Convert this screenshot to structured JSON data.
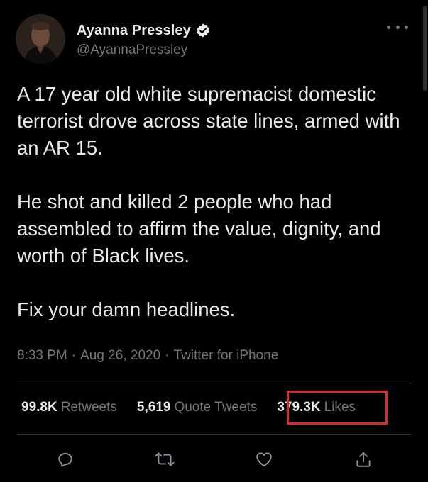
{
  "author": {
    "display_name": "Ayanna Pressley",
    "handle": "@AyannaPressley",
    "verified": true,
    "avatar_icon": "profile-photo"
  },
  "tweet": {
    "paragraphs": [
      "A 17 year old white supremacist domestic terrorist drove across state lines, armed with an AR 15.",
      "He shot and killed 2 people who had assembled to affirm the value, dignity, and worth of Black lives.",
      "Fix your damn headlines."
    ]
  },
  "meta": {
    "time": "8:33 PM",
    "separator": "·",
    "date": "Aug 26, 2020",
    "source": "Twitter for iPhone"
  },
  "stats": {
    "retweets_count": "99.8K",
    "retweets_label": "Retweets",
    "quotes_count": "5,619",
    "quotes_label": "Quote Tweets",
    "likes_count": "379.3K",
    "likes_label": "Likes"
  },
  "colors": {
    "background": "#000000",
    "text": "#e7e9ea",
    "secondary": "#71767b",
    "divider": "#2f3336",
    "highlight_box": "#e0282c"
  },
  "actions": [
    "reply-icon",
    "retweet-icon",
    "like-icon",
    "share-icon"
  ]
}
